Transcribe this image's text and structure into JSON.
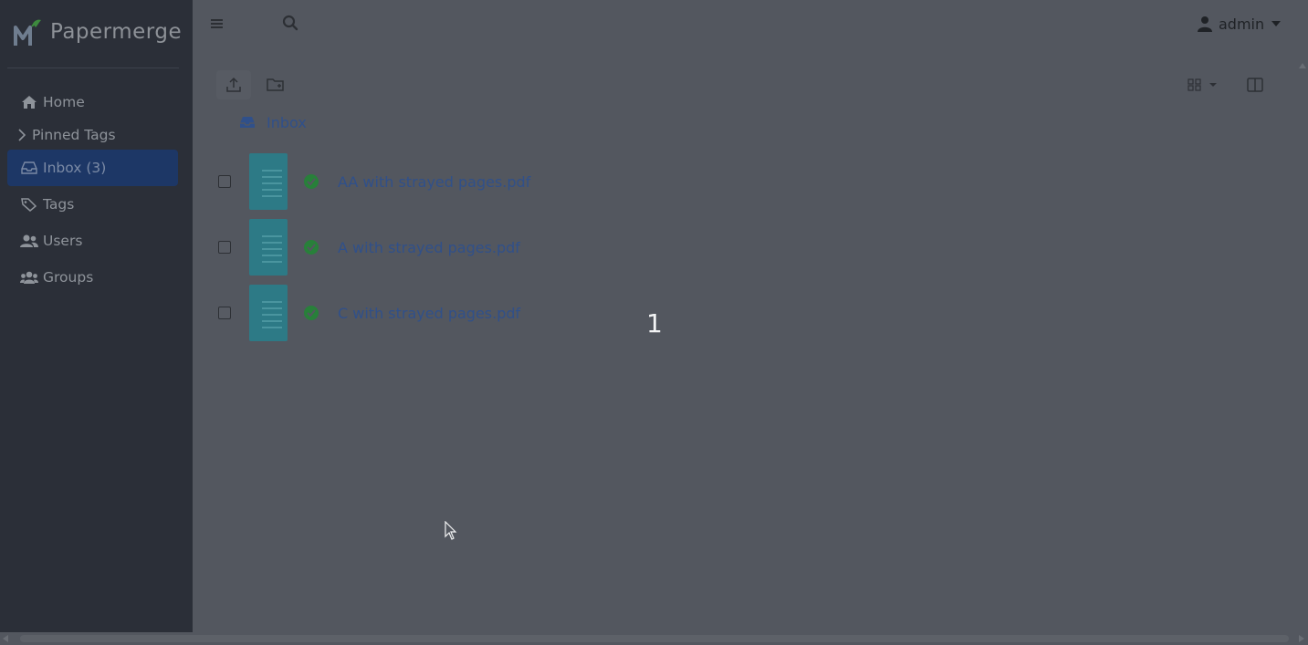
{
  "brand": {
    "name": "Papermerge"
  },
  "sidebar": {
    "items": [
      {
        "label": "Home",
        "icon": "home-icon"
      },
      {
        "label": "Pinned Tags",
        "icon": "chevron-right-icon"
      },
      {
        "label": "Inbox (3)",
        "icon": "inbox-icon",
        "active": true
      },
      {
        "label": "Tags",
        "icon": "tag-icon"
      },
      {
        "label": "Users",
        "icon": "users-icon"
      },
      {
        "label": "Groups",
        "icon": "groups-icon"
      }
    ]
  },
  "header": {
    "user_label": "admin"
  },
  "breadcrumb": {
    "label": "Inbox"
  },
  "documents": [
    {
      "title": "AA with strayed pages.pdf",
      "status": "ready"
    },
    {
      "title": "A with strayed pages.pdf",
      "status": "ready"
    },
    {
      "title": "C with strayed pages.pdf",
      "status": "ready"
    }
  ],
  "overlay": {
    "counter": "1"
  },
  "colors": {
    "sidebar_bg": "#2b2f38",
    "main_bg": "#53575f",
    "active_bg": "#1d3766",
    "link": "#30508a",
    "status_ok": "#28803a",
    "thumbnail": "#2d7a86"
  }
}
